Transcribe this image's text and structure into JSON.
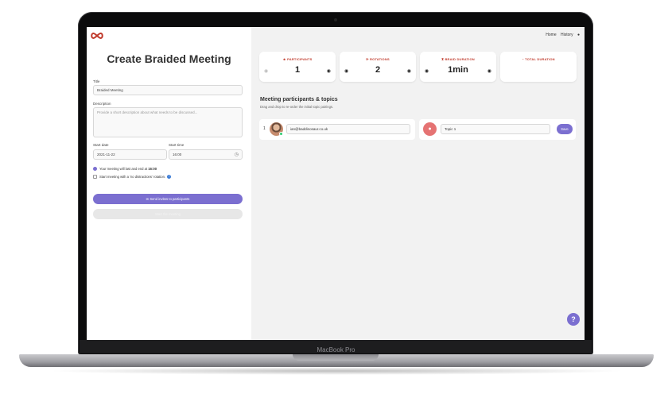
{
  "device": {
    "brand": "MacBook Pro"
  },
  "colors": {
    "accent": "#7b6fd0",
    "brand": "#c0392b",
    "topic_icon": "#e57373",
    "online": "#2ecc71"
  },
  "form": {
    "title": "Create Braided Meeting",
    "title_label": "Title",
    "title_value": "Braided Meeting",
    "description_label": "Description",
    "description_placeholder": "Provide a short description about what needs to be discussed...",
    "start_date_label": "Start date",
    "start_date_value": "2021-11-22",
    "start_time_label": "Start time",
    "start_time_value": "16:00",
    "info_prefix": "Your meeting will last and end at ",
    "info_time": "16:00",
    "no_distractions_label": "Start meeting with a 'no distractions' rotation.",
    "send_invites_label": "Send invites to participants",
    "start_meeting_label": "Start the meeting"
  },
  "nav": {
    "home": "Home",
    "history": "History"
  },
  "cards": [
    {
      "label": "PARTICIPANTS",
      "value": "1",
      "icon": "users-icon"
    },
    {
      "label": "ROTATIONS",
      "value": "2",
      "icon": "rotate-icon"
    },
    {
      "label": "BRAID DURATION",
      "value": "1min",
      "icon": "hourglass-icon"
    },
    {
      "label": "TOTAL DURATION",
      "value": "",
      "icon": "clock-icon"
    }
  ],
  "participants": {
    "title": "Meeting participants & topics",
    "subtitle": "Drag and drop to re-order the initial topic pairings.",
    "rows": [
      {
        "index": "1",
        "email": "ian@baddinosaur.co.uk",
        "topic": "Topic 1",
        "save_label": "Save"
      }
    ]
  }
}
